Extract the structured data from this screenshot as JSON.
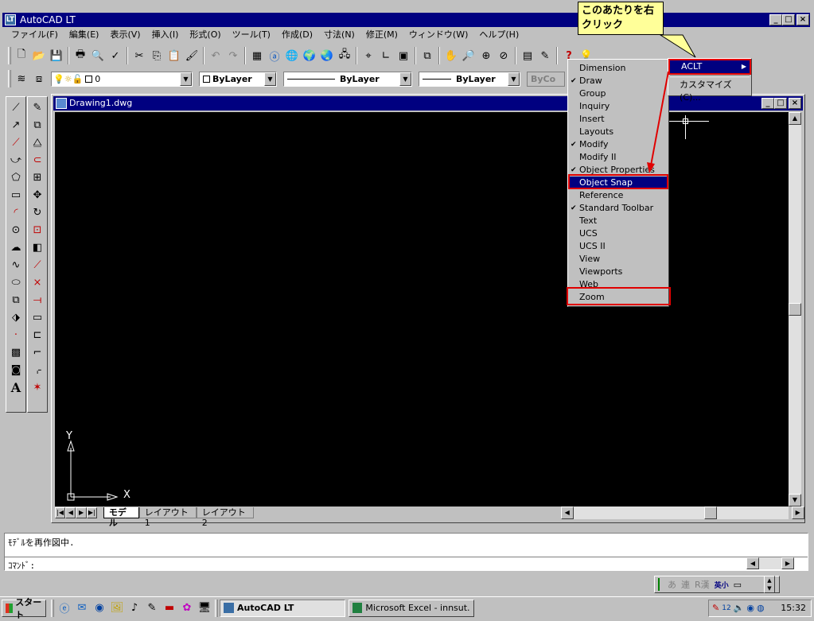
{
  "app": {
    "title": "AutoCAD LT",
    "title_icon": "autocad-icon"
  },
  "menu": [
    {
      "label": "ファイル(F)"
    },
    {
      "label": "編集(E)"
    },
    {
      "label": "表示(V)"
    },
    {
      "label": "挿入(I)"
    },
    {
      "label": "形式(O)"
    },
    {
      "label": "ツール(T)"
    },
    {
      "label": "作成(D)"
    },
    {
      "label": "寸法(N)"
    },
    {
      "label": "修正(M)"
    },
    {
      "label": "ウィンドウ(W)"
    },
    {
      "label": "ヘルプ(H)"
    }
  ],
  "callout": {
    "text": "このあたりを右クリック",
    "line1": "このあたりを右",
    "line2": "クリック"
  },
  "properties_toolbar": {
    "layer_value": "0",
    "color_value": "ByLayer",
    "linetype_value": "ByLayer",
    "lineweight_value": "ByLayer",
    "plotstyle_value": "ByCo"
  },
  "drawing": {
    "title": "Drawing1.dwg",
    "tabs": [
      "モデル",
      "レイアウト1",
      "レイアウト2"
    ],
    "axis_x": "X",
    "axis_y": "Y"
  },
  "context_menu": {
    "items": [
      {
        "label": "Dimension",
        "checked": false,
        "highlight": false
      },
      {
        "label": "Draw",
        "checked": true,
        "highlight": false
      },
      {
        "label": "Group",
        "checked": false,
        "highlight": false
      },
      {
        "label": "Inquiry",
        "checked": false,
        "highlight": false
      },
      {
        "label": "Insert",
        "checked": false,
        "highlight": false
      },
      {
        "label": "Layouts",
        "checked": false,
        "highlight": false
      },
      {
        "label": "Modify",
        "checked": true,
        "highlight": false
      },
      {
        "label": "Modify II",
        "checked": false,
        "highlight": false
      },
      {
        "label": "Object Properties",
        "checked": true,
        "highlight": false
      },
      {
        "label": "Object Snap",
        "checked": false,
        "highlight": true
      },
      {
        "label": "Reference",
        "checked": false,
        "highlight": false
      },
      {
        "label": "Standard Toolbar",
        "checked": true,
        "highlight": false
      },
      {
        "label": "Text",
        "checked": false,
        "highlight": false
      },
      {
        "label": "UCS",
        "checked": false,
        "highlight": false
      },
      {
        "label": "UCS II",
        "checked": false,
        "highlight": false
      },
      {
        "label": "View",
        "checked": false,
        "highlight": false
      },
      {
        "label": "Viewports",
        "checked": false,
        "highlight": false
      },
      {
        "label": "Web",
        "checked": false,
        "highlight": false
      },
      {
        "label": "Zoom",
        "checked": false,
        "highlight": false
      }
    ]
  },
  "submenu": {
    "aclt": "ACLT",
    "customize": "カスタマイズ(C)..."
  },
  "command": {
    "history": "ﾓﾃﾞﾙを再作図中.",
    "prompt": "ｺﾏﾝﾄﾞ:"
  },
  "ime_bar": {
    "labels": [
      "あ",
      "連",
      "R漢",
      "英小"
    ]
  },
  "taskbar": {
    "start": "スタート",
    "tasks": [
      {
        "label": "AutoCAD LT"
      },
      {
        "label": "Microsoft Excel - innsut..."
      }
    ],
    "clock": "15:32"
  },
  "colors": {
    "title": "#000080",
    "canvas": "#000000",
    "red_box": "#e00000",
    "callout": "#ffff99"
  }
}
